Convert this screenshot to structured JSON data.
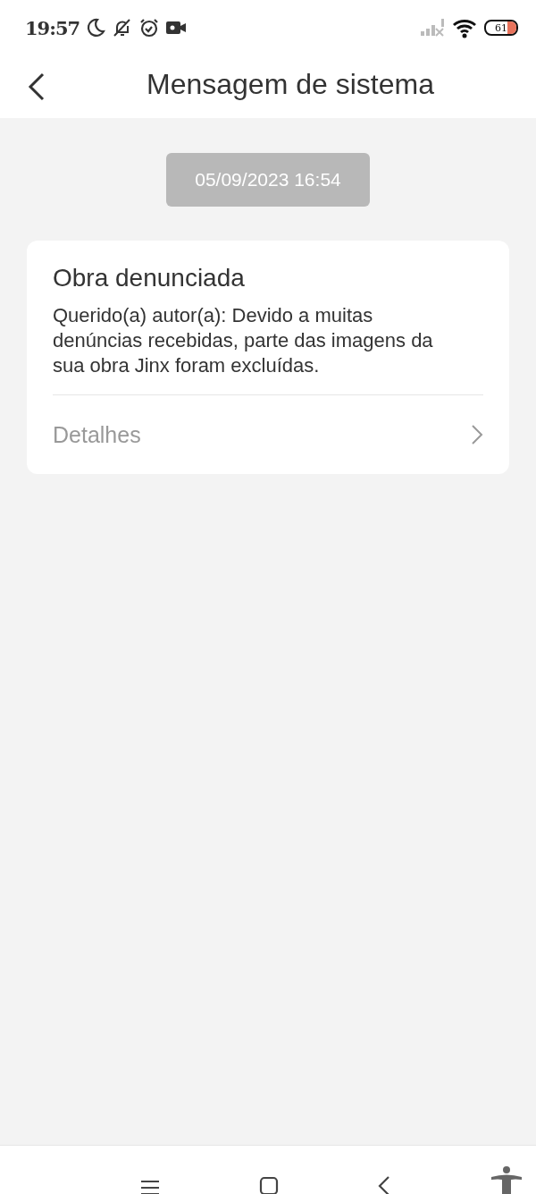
{
  "status_bar": {
    "time": "19:57",
    "battery": "61"
  },
  "header": {
    "title": "Mensagem de sistema"
  },
  "timestamp": "05/09/2023 16:54",
  "message": {
    "title": "Obra denunciada",
    "body": "Querido(a) autor(a): Devido a muitas denúncias recebidas, parte das imagens da sua obra Jinx foram excluídas.",
    "link": "Detalhes"
  }
}
